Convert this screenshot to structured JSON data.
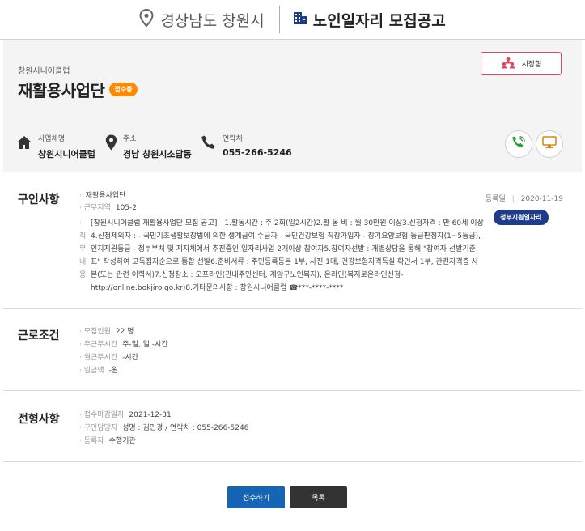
{
  "header": {
    "region": "경상남도 창원시",
    "title": "노인일자리 모집공고"
  },
  "job": {
    "org_small": "창원시니어클럽",
    "title": "재활용사업단",
    "status": "접수중",
    "type_label": "시장형",
    "business_label": "사업체명",
    "business_value": "창원시니어클럽",
    "address_label": "주소",
    "address_value": "경남 창원시소답동",
    "contact_label": "연락처",
    "contact_value": "055-266-5246"
  },
  "recruit": {
    "title": "구인사항",
    "job_name": "재활용사업단",
    "area_label": "근무지역",
    "area_value": "105-2",
    "duty_label": "직무내용",
    "duty_text": "[창원시니어클럽 재활용사업단 모집 공고]　1.활동시간 : 주 2회(일2시간)2.활 동 비 : 월 30만원 이상3.신청자격 : 만 60세 이상4.신청제외자 : - 국민기초생활보장법에 의한 생계급여 수급자 - 국민건강보험 직장가입자 - 장기요양보험 등급판정자(1~5등급), 인지지원등급 - 정부부처 및 지자체에서 추진중인 일자리사업 2개이상 참여자5.참여자선발 : 개별상담을 통해 \"참여자 선발기준표\" 작성하여 고득점자순으로 통합 선발6.준비서류 : 주민등록등본 1부, 사진 1매, 건강보험자격득실 확인서 1부, 관련자격증 사본(또는 관련 이력서)7.신청장소 : 오프라인(관내주민센터, 계양구노인복지), 온라인(복지로온라인신청-http://online.bokjiro.go.kr)8.기타문의사항 : 창원시니어클럽 ☎***-****-****",
    "reg_label": "등록일",
    "reg_date": "2020-11-19",
    "gov_badge": "정부지원일자리"
  },
  "work": {
    "title": "근로조건",
    "people_label": "모집인원",
    "people_value": "22 명",
    "week_label": "주근무시간",
    "week_value": "주-일, 일 -시간",
    "month_label": "월근무시간",
    "month_value": "-시간",
    "wage_label": "임금액",
    "wage_value": "-원"
  },
  "select": {
    "title": "전형사항",
    "deadline_label": "접수마감일자",
    "deadline_value": "2021-12-31",
    "manager_label": "구인담당자",
    "manager_value": "성명 : 김민경 / 연락처 : 055-266-5246",
    "registrant_label": "등록자",
    "registrant_value": "수행기관"
  },
  "buttons": {
    "apply": "접수하기",
    "list": "목록"
  },
  "colors": {
    "status_orange": "#ff8a00",
    "type_border": "#e0475e",
    "gov_badge": "#1f3c88",
    "apply_button": "#1565b4",
    "list_button": "#333333",
    "call_icon": "#2e9e3f",
    "screen_icon": "#d98a14"
  },
  "icons": [
    "location-pin-icon",
    "building-icon",
    "people-icon",
    "home-icon",
    "map-pin-icon",
    "phone-icon",
    "call-icon",
    "monitor-icon"
  ]
}
